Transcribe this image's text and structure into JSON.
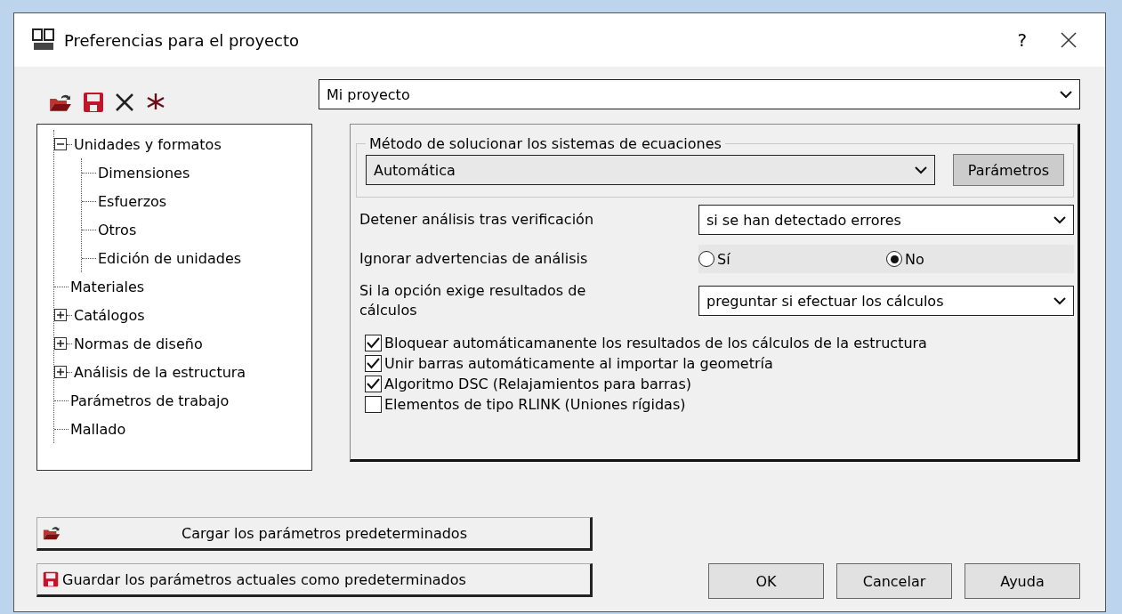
{
  "window": {
    "title": "Preferencias para el proyecto",
    "help": "?"
  },
  "project": {
    "value": "Mi proyecto"
  },
  "tree": [
    {
      "label": "Unidades y formatos",
      "expanded": true,
      "children": [
        {
          "label": "Dimensiones"
        },
        {
          "label": "Esfuerzos"
        },
        {
          "label": "Otros"
        },
        {
          "label": "Edición de unidades"
        }
      ]
    },
    {
      "label": "Materiales"
    },
    {
      "label": "Catálogos",
      "expanded": false
    },
    {
      "label": "Normas de diseño",
      "expanded": false
    },
    {
      "label": "Análisis de la estructura",
      "expanded": false
    },
    {
      "label": "Parámetros de trabajo"
    },
    {
      "label": "Mallado"
    }
  ],
  "solver_group": {
    "title": "Método de solucionar los sistemas de ecuaciones",
    "value": "Automática",
    "button": "Parámetros"
  },
  "settings": [
    {
      "kind": "select",
      "label": "Detener análisis tras verificación",
      "value": "si se han detectado errores"
    },
    {
      "kind": "radio",
      "label": "Ignorar advertencias de análisis",
      "options": [
        {
          "label": "Sí",
          "selected": false
        },
        {
          "label": "No",
          "selected": true
        }
      ]
    },
    {
      "kind": "select",
      "label": "Si la opción exige resultados de cálculos",
      "value": "preguntar si efectuar los cálculos"
    }
  ],
  "checkboxes": [
    {
      "label": "Bloquear automáticamanente los resultados de los cálculos de la estructura",
      "checked": true
    },
    {
      "label": "Unir barras automáticamente al importar la geometría",
      "checked": true
    },
    {
      "label": "Algoritmo DSC (Relajamientos para barras)",
      "checked": true
    },
    {
      "label": "Elementos de tipo RLINK (Uniones rígidas)",
      "checked": false
    }
  ],
  "default_buttons": [
    {
      "label": "Cargar los parámetros predeterminados",
      "kind": "load"
    },
    {
      "label": "Guardar los parámetros actuales como predeterminados",
      "kind": "save"
    }
  ],
  "buttons": [
    "OK",
    "Cancelar",
    "Ayuda"
  ]
}
